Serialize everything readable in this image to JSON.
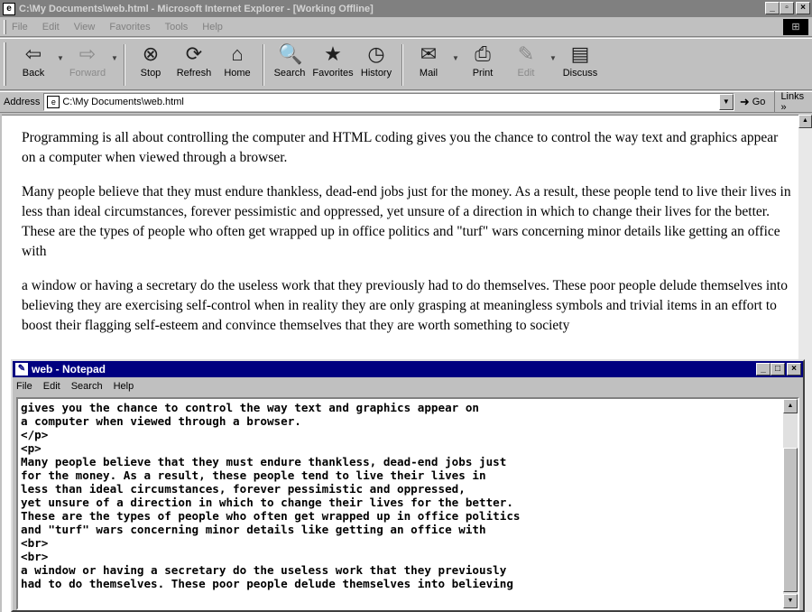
{
  "ie": {
    "title": "C:\\My Documents\\web.html - Microsoft Internet Explorer - [Working Offline]",
    "menu": [
      "File",
      "Edit",
      "View",
      "Favorites",
      "Tools",
      "Help"
    ],
    "toolbar": [
      {
        "label": "Back",
        "icon": "⇦",
        "name": "back",
        "enabled": true,
        "dropdown": true
      },
      {
        "label": "Forward",
        "icon": "⇨",
        "name": "forward",
        "enabled": false,
        "dropdown": true
      },
      {
        "label": "Stop",
        "icon": "⊗",
        "name": "stop",
        "enabled": true
      },
      {
        "label": "Refresh",
        "icon": "⟳",
        "name": "refresh",
        "enabled": true
      },
      {
        "label": "Home",
        "icon": "⌂",
        "name": "home",
        "enabled": true
      },
      {
        "label": "Search",
        "icon": "🔍",
        "name": "search",
        "enabled": true
      },
      {
        "label": "Favorites",
        "icon": "★",
        "name": "favorites",
        "enabled": true
      },
      {
        "label": "History",
        "icon": "◷",
        "name": "history",
        "enabled": true
      },
      {
        "label": "Mail",
        "icon": "✉",
        "name": "mail",
        "enabled": true,
        "dropdown": true
      },
      {
        "label": "Print",
        "icon": "⎙",
        "name": "print",
        "enabled": true
      },
      {
        "label": "Edit",
        "icon": "✎",
        "name": "edit",
        "enabled": false,
        "dropdown": true
      },
      {
        "label": "Discuss",
        "icon": "▤",
        "name": "discuss",
        "enabled": true
      }
    ],
    "address_label": "Address",
    "address_value": "C:\\My Documents\\web.html",
    "go_label": "Go",
    "links_label": "Links »",
    "paragraphs": [
      "Programming is all about controlling the computer and HTML coding gives you the chance to control the way text and graphics appear on a computer when viewed through a browser.",
      "Many people believe that they must endure thankless, dead-end jobs just for the money. As a result, these people tend to live their lives in less than ideal circumstances, forever pessimistic and oppressed, yet unsure of a direction in which to change their lives for the better. These are the types of people who often get wrapped up in office politics and \"turf\" wars concerning minor details like getting an office with",
      "a window or having a secretary do the useless work that they previously had to do themselves. These poor people delude themselves into believing they are exercising self-control when in reality they are only grasping at meaningless symbols and trivial items in an effort to boost their flagging self-esteem and convince themselves that they are worth something to society"
    ]
  },
  "notepad": {
    "title": "web - Notepad",
    "menu": [
      "File",
      "Edit",
      "Search",
      "Help"
    ],
    "lines": [
      "gives you the chance to control the way text and graphics appear on",
      "a computer when viewed through a browser.",
      "</p>",
      "<p>",
      "Many people believe that they must endure thankless, dead-end jobs just",
      "for the money. As a result, these people tend to live their lives in",
      "less than ideal circumstances, forever pessimistic and oppressed,",
      "yet unsure of a direction in which to change their lives for the better.",
      "These are the types of people who often get wrapped up in office politics",
      "and \"turf\" wars concerning minor details like getting an office with",
      "<br>",
      "<br>",
      "a window or having a secretary do the useless work that they previously",
      "had to do themselves. These poor people delude themselves into believing"
    ]
  }
}
